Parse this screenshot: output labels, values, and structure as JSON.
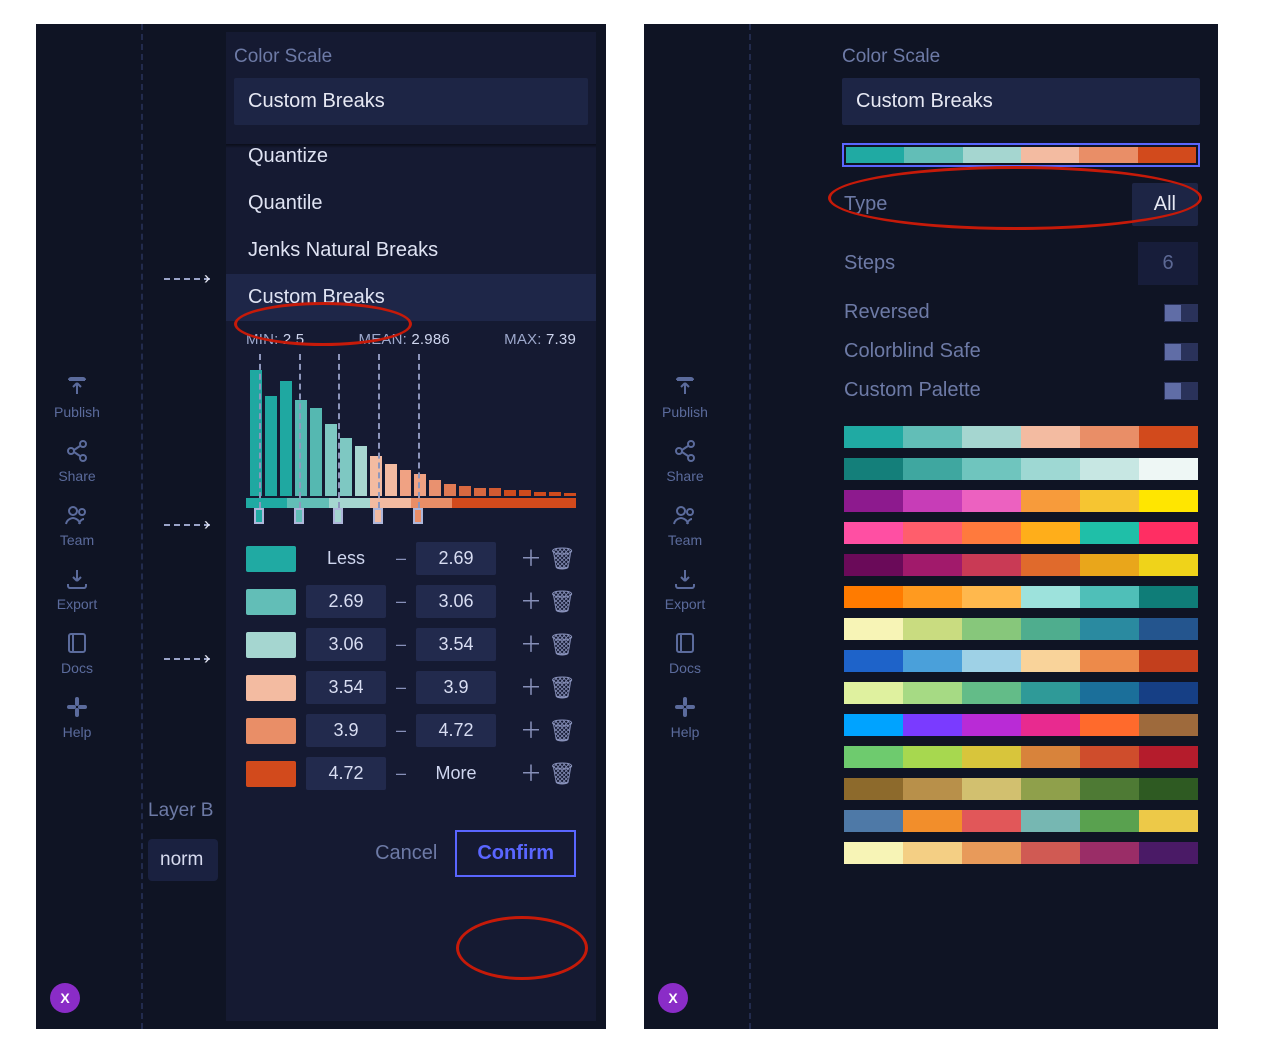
{
  "sidebar": {
    "items": [
      {
        "label": "Publish",
        "icon": "upload-bracket"
      },
      {
        "label": "Share",
        "icon": "share-nodes"
      },
      {
        "label": "Team",
        "icon": "users"
      },
      {
        "label": "Export",
        "icon": "download-tray"
      },
      {
        "label": "Docs",
        "icon": "book"
      },
      {
        "label": "Help",
        "icon": "slack"
      }
    ],
    "x_label": "X"
  },
  "left_panel": {
    "section_title": "Color Scale",
    "selected_label": "Custom Breaks",
    "options": [
      "Quantize",
      "Quantile",
      "Jenks Natural Breaks",
      "Custom Breaks"
    ],
    "stats": {
      "min_label": "MIN:",
      "min": "2.5",
      "mean_label": "MEAN:",
      "mean": "2.986",
      "max_label": "MAX:",
      "max": "7.39"
    },
    "histogram": {
      "colors": [
        "#1fa8a1",
        "#1fa8a1",
        "#1fa8a1",
        "#55b8b1",
        "#55b8b1",
        "#7ec8c2",
        "#7ec8c2",
        "#a7d6d0",
        "#f3bba1",
        "#f3bba1",
        "#f0a283",
        "#f0a283",
        "#e9916f",
        "#e07a54",
        "#d86840",
        "#d86840",
        "#d15a32",
        "#cf4b1d",
        "#cf4b1d",
        "#cf4b1d",
        "#cf4b1d",
        "#cf4b1d"
      ],
      "heights": [
        126,
        100,
        115,
        96,
        88,
        72,
        58,
        50,
        40,
        32,
        26,
        22,
        16,
        12,
        10,
        8,
        8,
        6,
        6,
        4,
        4,
        3
      ]
    },
    "gradient_swatches": [
      "#20aaa3",
      "#62beb7",
      "#a5d6d0",
      "#f3bba1",
      "#e98e67",
      "#d24a1c"
    ],
    "breaks": [
      {
        "color": "#20aaa3",
        "from": "Less",
        "to": "2.69",
        "from_boxed": false
      },
      {
        "color": "#62beb7",
        "from": "2.69",
        "to": "3.06",
        "from_boxed": true
      },
      {
        "color": "#a5d6d0",
        "from": "3.06",
        "to": "3.54",
        "from_boxed": true
      },
      {
        "color": "#f3bba1",
        "from": "3.54",
        "to": "3.9",
        "from_boxed": true
      },
      {
        "color": "#e98e67",
        "from": "3.9",
        "to": "4.72",
        "from_boxed": true
      },
      {
        "color": "#d24a1c",
        "from": "4.72",
        "to": "More",
        "from_boxed": true,
        "to_boxed": false
      }
    ],
    "dash_positions_pct": [
      4,
      16,
      28,
      40,
      52
    ],
    "handle_colors": [
      "#20aaa3",
      "#62beb7",
      "#a5d6d0",
      "#f3bba1",
      "#e98e67"
    ],
    "cancel": "Cancel",
    "confirm": "Confirm",
    "layer_peek": "Layer B",
    "norm_peek": "norm"
  },
  "right_panel": {
    "section_title": "Color Scale",
    "selected_label": "Custom Breaks",
    "current_palette": [
      "#20aaa3",
      "#62beb7",
      "#a5d6d0",
      "#f3bba1",
      "#e98e67",
      "#d24a1c"
    ],
    "type_label": "Type",
    "type_value": "All",
    "steps_label": "Steps",
    "steps_value": "6",
    "toggles": [
      {
        "label": "Reversed"
      },
      {
        "label": "Colorblind Safe"
      },
      {
        "label": "Custom Palette"
      }
    ],
    "palettes": [
      [
        "#20aaa3",
        "#62beb7",
        "#a5d6d0",
        "#f3bba1",
        "#e98e67",
        "#d24a1c"
      ],
      [
        "#147f7a",
        "#3fa7a0",
        "#6fc5be",
        "#9ed8d3",
        "#c7e7e3",
        "#eef7f5"
      ],
      [
        "#8d1a8e",
        "#c73db7",
        "#ec61c0",
        "#f79b3b",
        "#f6c531",
        "#ffe600"
      ],
      [
        "#ff4fa3",
        "#ff5e6c",
        "#ff7a3d",
        "#ffae1a",
        "#1fbfa8",
        "#ff2e63"
      ],
      [
        "#6a0a59",
        "#a11a6b",
        "#c93a55",
        "#e06a2c",
        "#e9a61b",
        "#efd31a"
      ],
      [
        "#ff7b00",
        "#ff9a1f",
        "#ffb84d",
        "#9de2dc",
        "#4fbfb8",
        "#0f7d78"
      ],
      [
        "#f7f4b6",
        "#c9dc80",
        "#87c77b",
        "#4fad8e",
        "#2a8aa0",
        "#24558e"
      ],
      [
        "#1e63c9",
        "#4aa0da",
        "#9ed1e6",
        "#f9d39a",
        "#ed8a4a",
        "#c33f1d"
      ],
      [
        "#dff19f",
        "#a6da84",
        "#63bc88",
        "#2f9a98",
        "#1b6f9a",
        "#163f85"
      ],
      [
        "#00a3ff",
        "#7a3bff",
        "#b92bd6",
        "#e82a8f",
        "#ff6a2c",
        "#9e6a3c"
      ],
      [
        "#6ecb6e",
        "#a7d84f",
        "#d8c53b",
        "#d8833b",
        "#cf4d2c",
        "#b51c2c"
      ],
      [
        "#8d6a2c",
        "#b8904a",
        "#d2c06f",
        "#8fa04b",
        "#4e7a34",
        "#2e5a22"
      ],
      [
        "#4e79a7",
        "#f28e2b",
        "#e15759",
        "#76b7b2",
        "#59a14f",
        "#edc948"
      ],
      [
        "#f7f4b6",
        "#f4cf84",
        "#e89a5a",
        "#d05a53",
        "#9a2d67",
        "#4a1a66"
      ]
    ]
  }
}
